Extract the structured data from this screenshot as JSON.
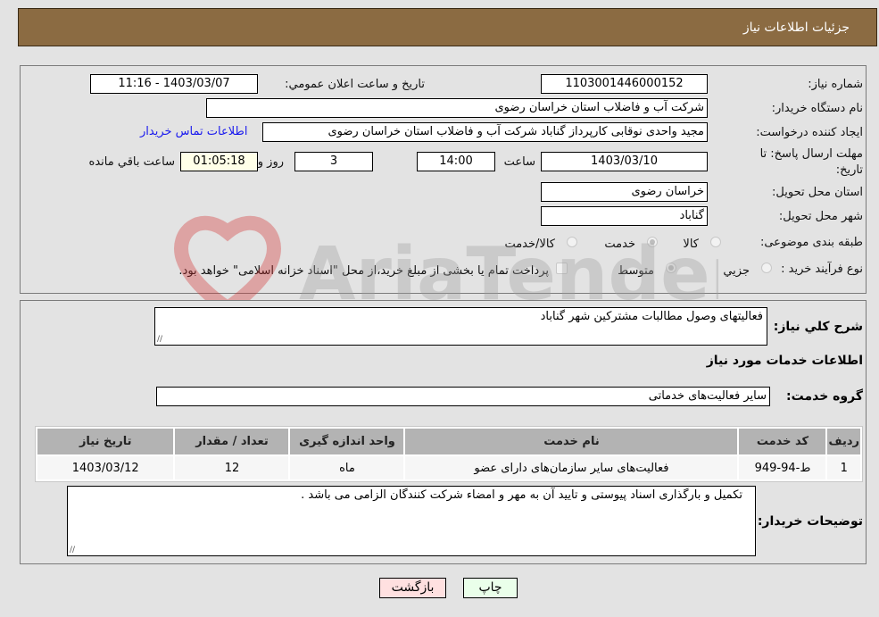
{
  "header": {
    "title": "جزئيات اطلاعات نياز"
  },
  "details": {
    "need_number_label": "شماره نياز:",
    "need_number": "1103001446000152",
    "announce_label": "تاريخ و ساعت اعلان عمومي:",
    "announce_value": "1403/03/07 - 11:16",
    "buyer_org_label": "نام دستگاه خريدار:",
    "buyer_org": "شرکت آب و فاضلاب استان خراسان رضوی",
    "creator_label": "ايجاد کننده درخواست:",
    "creator": "مجيد واحدی نوقابی کارپرداز گناباد  شرکت آب و فاضلاب استان خراسان رضوی",
    "contact_link": "اطلاعات تماس خريدار",
    "deadline_label_1": "مهلت ارسال پاسخ: تا",
    "deadline_label_2": "تاريخ:",
    "deadline_date": "1403/03/10",
    "time_label": "ساعت",
    "deadline_time": "14:00",
    "days_value": "3",
    "days_label": "روز و",
    "remaining_time": "01:05:18",
    "remaining_label": "ساعت باقي مانده",
    "province_label": "استان محل تحويل:",
    "province": "خراسان رضوی",
    "city_label": "شهر محل تحويل:",
    "city": "گناباد",
    "category_label": "طبقه بندی موضوعی:",
    "category_options": [
      {
        "label": "کالا",
        "checked": false
      },
      {
        "label": "خدمت",
        "checked": true
      },
      {
        "label": "کالا/خدمت",
        "checked": false
      }
    ],
    "process_label": "نوع فرآيند خريد :",
    "process_options": [
      {
        "label": "جزيي",
        "checked": false
      },
      {
        "label": "متوسط",
        "checked": true
      }
    ],
    "treasury_note": "پرداخت تمام يا بخشی از مبلغ خريد،از محل \"اسناد خزانه اسلامی\" خواهد بود."
  },
  "services": {
    "general_desc_label": "شرح کلي نياز:",
    "general_desc": "فعاليتهای وصول مطالبات مشترکين شهر گناباد",
    "section_title": "اطلاعات خدمات مورد نياز",
    "group_label": "گروه خدمت:",
    "group_value": "ساير فعاليت‌های خدماتی",
    "table": {
      "headers": [
        "رديف",
        "کد خدمت",
        "نام خدمت",
        "واحد اندازه گيری",
        "تعداد / مقدار",
        "تاريخ نياز"
      ],
      "rows": [
        [
          "1",
          "ط-94-949",
          "فعاليت‌های ساير سازمان‌های دارای عضو",
          "ماه",
          "12",
          "1403/03/12"
        ]
      ]
    },
    "buyer_notes_label": "توضيحات خريدار:",
    "buyer_notes": "تکميل و بارگذاری اسناد  پيوستی   و تاييد آن به  مهر و امضاء شرکت  کنندگان  الزامی می باشد ."
  },
  "buttons": {
    "print": "چاپ",
    "back": "بازگشت"
  },
  "watermark": {
    "text": "AriaTender.neT"
  },
  "colors": {
    "header_bg": "#8b6b42",
    "link": "#1a1aee",
    "print_bg": "#eaffea",
    "back_bg": "#ffe0e0"
  }
}
